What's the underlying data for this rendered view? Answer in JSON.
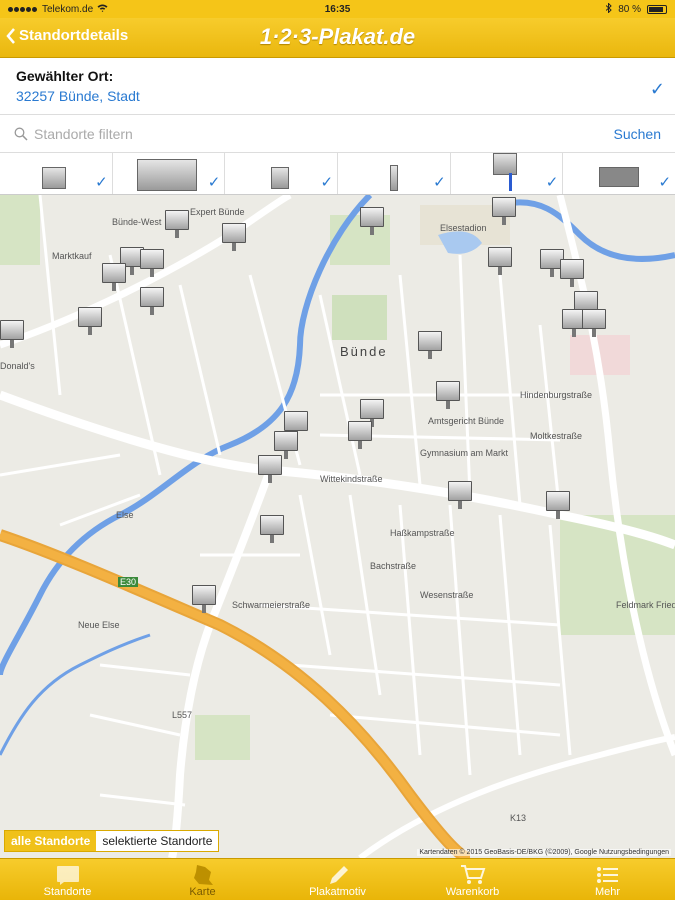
{
  "status": {
    "carrier": "Telekom.de",
    "time": "16:35",
    "battery": "80 %"
  },
  "nav": {
    "back_label": "Standortdetails",
    "logo": "1·2·3-Plakat.de"
  },
  "location": {
    "label": "Gewählter Ort:",
    "value": "32257 Bünde, Stadt"
  },
  "filter": {
    "placeholder": "Standorte filtern",
    "button": "Suchen"
  },
  "types": [
    {
      "name": "type-1",
      "checked": true
    },
    {
      "name": "type-2",
      "checked": true
    },
    {
      "name": "type-3",
      "checked": true
    },
    {
      "name": "type-4",
      "checked": true
    },
    {
      "name": "type-5",
      "checked": true
    },
    {
      "name": "type-6",
      "checked": true
    }
  ],
  "map": {
    "labels": {
      "bunde": "Bünde",
      "bunde_west": "Bünde-West",
      "amtsgericht": "Amtsgericht Bünde",
      "gymnasium": "Gymnasium am Markt",
      "elsestadion": "Elsestadion",
      "wittekind": "Wittekindstraße",
      "schwarmeier": "Schwarmeierstraße",
      "neue_else": "Neue Else",
      "else": "Else",
      "feldmark": "Feldmark Fried",
      "hindenburg": "Hindenburgstraße",
      "moltke": "Moltkestraße",
      "hasekamp": "Haßkampstraße",
      "bachstr": "Bachstraße",
      "weseschstr": "Wesenstraße",
      "e30": "E30",
      "l557": "L557",
      "k13": "K13",
      "mcdonalds": "Donald's",
      "expert": "Expert Bünde",
      "marktkauf": "Marktkauf"
    },
    "copyright": "Kartendaten © 2015 GeoBasis-DE/BKG (©2009), Google   Nutzungsbedingungen"
  },
  "segment": {
    "all": "alle Standorte",
    "selected": "selektierte Standorte"
  },
  "tabs": [
    {
      "label": "Standorte",
      "icon": "list-icon"
    },
    {
      "label": "Karte",
      "icon": "map-icon"
    },
    {
      "label": "Plakatmotiv",
      "icon": "pencil-icon"
    },
    {
      "label": "Warenkorb",
      "icon": "cart-icon"
    },
    {
      "label": "Mehr",
      "icon": "more-icon"
    }
  ]
}
